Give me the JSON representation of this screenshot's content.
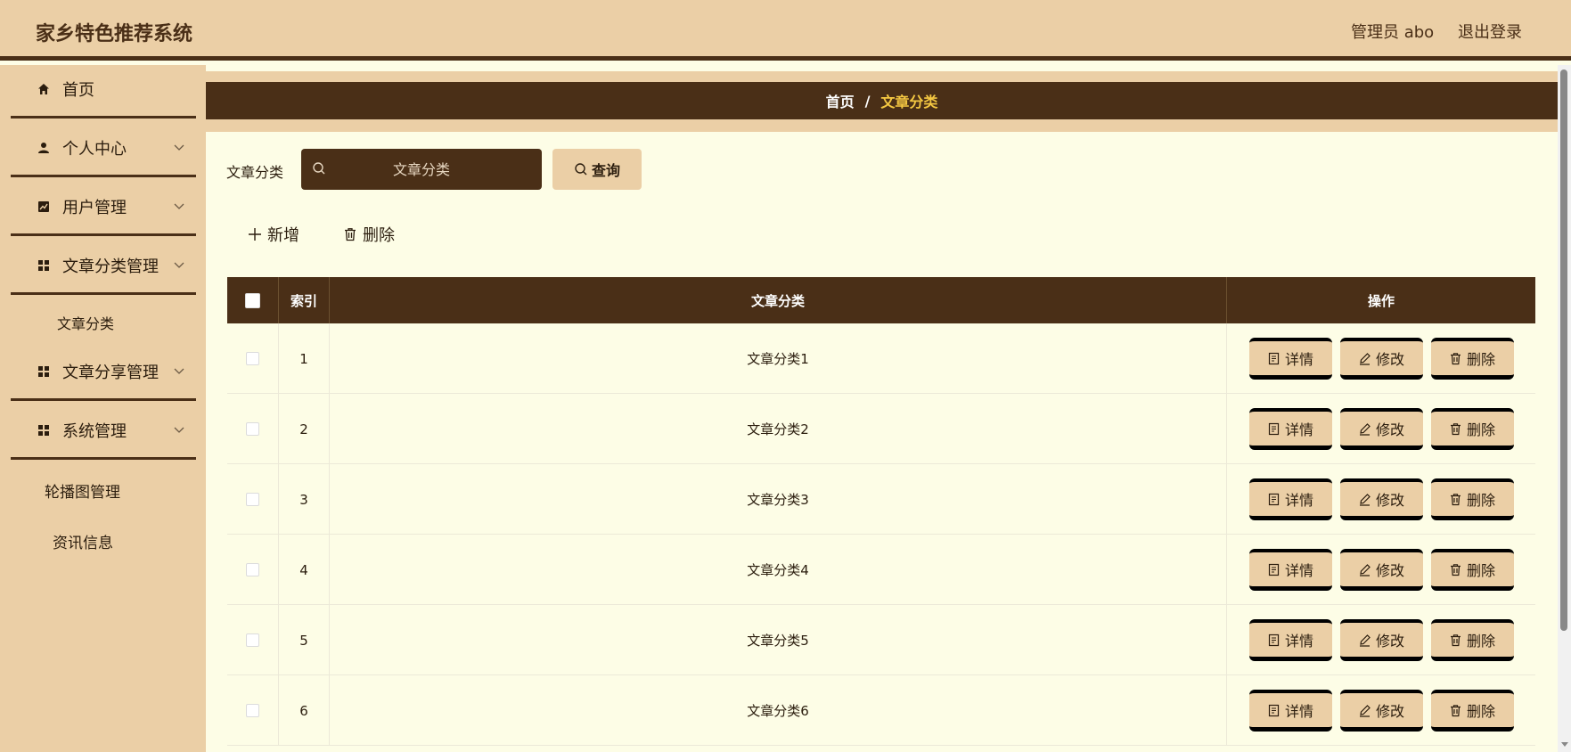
{
  "header": {
    "title": "家乡特色推荐系统",
    "user": "管理员 abo",
    "logout": "退出登录"
  },
  "sidebar": {
    "items": [
      {
        "label": "首页",
        "icon": "home-icon"
      },
      {
        "label": "个人中心",
        "icon": "user-icon"
      },
      {
        "label": "用户管理",
        "icon": "chart-icon"
      },
      {
        "label": "文章分类管理",
        "icon": "grid-icon"
      },
      {
        "label": "文章分享管理",
        "icon": "grid-icon"
      },
      {
        "label": "系统管理",
        "icon": "grid-icon"
      }
    ],
    "sub_article_category": "文章分类",
    "sub_carousel": "轮播图管理",
    "sub_news": "资讯信息"
  },
  "breadcrumb": {
    "home": "首页",
    "separator": "/",
    "current": "文章分类"
  },
  "search": {
    "label": "文章分类",
    "placeholder": "文章分类",
    "query_button": "查询"
  },
  "actions": {
    "add": "新增",
    "delete": "删除"
  },
  "table": {
    "headers": {
      "index": "索引",
      "category": "文章分类",
      "operations": "操作"
    },
    "op_labels": {
      "detail": "详情",
      "edit": "修改",
      "delete": "删除"
    },
    "rows": [
      {
        "index": "1",
        "category": "文章分类1"
      },
      {
        "index": "2",
        "category": "文章分类2"
      },
      {
        "index": "3",
        "category": "文章分类3"
      },
      {
        "index": "4",
        "category": "文章分类4"
      },
      {
        "index": "5",
        "category": "文章分类5"
      },
      {
        "index": "6",
        "category": "文章分类6"
      }
    ]
  },
  "colors": {
    "primary_dark": "#4a2f17",
    "primary_light": "#ebcfa6",
    "background": "#fdfde6",
    "breadcrumb_current": "#f5c842"
  }
}
